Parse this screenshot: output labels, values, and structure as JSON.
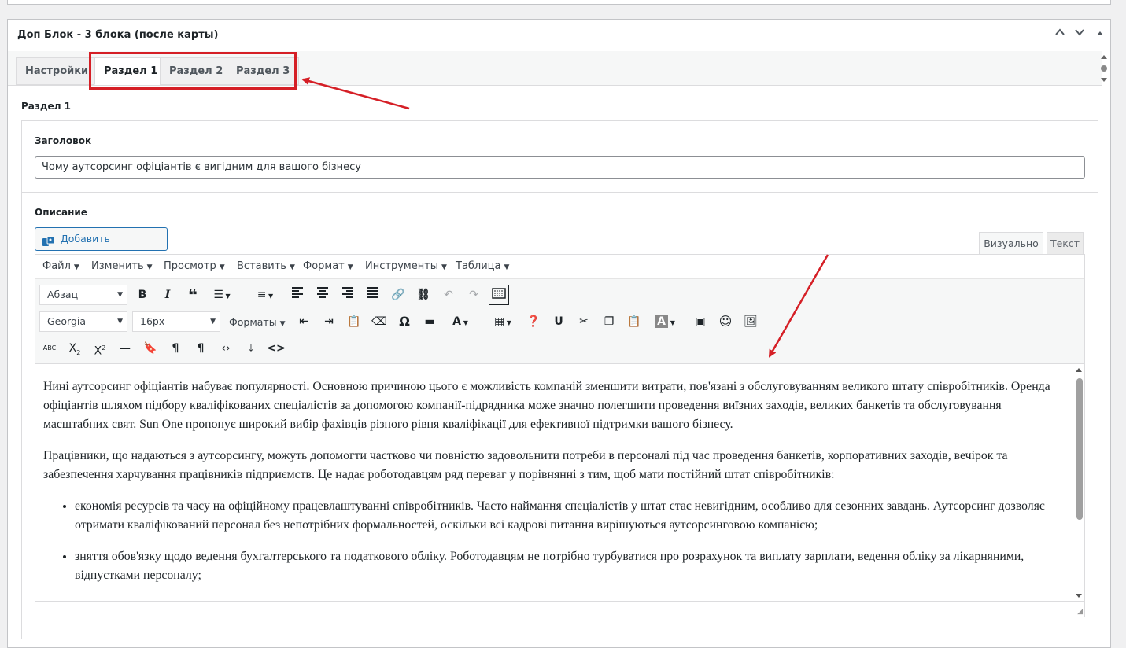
{
  "panel": {
    "title": "Доп Блок - 3 блока (после карты)",
    "up_label": "︿",
    "down_label": "﹀",
    "toggle_label": "▲"
  },
  "tabs": [
    {
      "label": "Настройки"
    },
    {
      "label": "Раздел 1"
    },
    {
      "label": "Раздел 2"
    },
    {
      "label": "Раздел 3"
    }
  ],
  "section": {
    "label": "Раздел 1",
    "title_field_label": "Заголовок",
    "title_value": "Чому аутсорсинг офіціантів є вигідним для вашого бізнесу",
    "description_label": "Описание"
  },
  "editor": {
    "add_media_label": "Добавить медиафайл",
    "mode_visual": "Визуально",
    "mode_text": "Текст",
    "menu": [
      "Файл",
      "Изменить",
      "Просмотр",
      "Вставить",
      "Формат",
      "Инструменты",
      "Таблица"
    ],
    "block_format": "Абзац",
    "font_family": "Georgia",
    "font_size": "16px",
    "formats_label": "Форматы",
    "content": {
      "p1": "Нині аутсорсинг офіціантів набуває популярності. Основною причиною цього є можливість компаній зменшити витрати, пов'язані з обслуговуванням великого штату співробітників. Оренда офіціантів шляхом підбору кваліфікованих спеціалістів за допомогою компанії-підрядника може значно полегшити проведення виїзних заходів, великих банкетів та обслуговування масштабних свят. Sun One пропонує широкий вибір фахівців різного рівня кваліфікації для ефективної підтримки вашого бізнесу.",
      "p2": "Працівники, що надаються з аутсорсингу, можуть допомогти частково чи повністю задовольнити потреби в персоналі під час проведення банкетів, корпоративних заходів, вечірок та забезпечення харчування працівників підприємств. Це надає роботодавцям ряд переваг у порівнянні з тим, щоб мати постійний штат співробітників:",
      "li1": "економія ресурсів та часу на офіційному працевлаштуванні співробітників. Часто наймання спеціалістів у штат стає невигідним, особливо для сезонних завдань. Аутсорсинг дозволяє отримати кваліфікований персонал без непотрібних формальностей, оскільки всі кадрові питання вирішуються аутсорсинговою компанією;",
      "li2": "зняття обов'язку щодо ведення бухгалтерського та податкового обліку. Роботодавцям не потрібно турбуватися про розрахунок та виплату зарплати, ведення обліку за лікарняними, відпустками персоналу;"
    }
  },
  "colors": {
    "accent": "#2271b1",
    "annotation": "#d51f26",
    "border": "#c3c4c7"
  }
}
